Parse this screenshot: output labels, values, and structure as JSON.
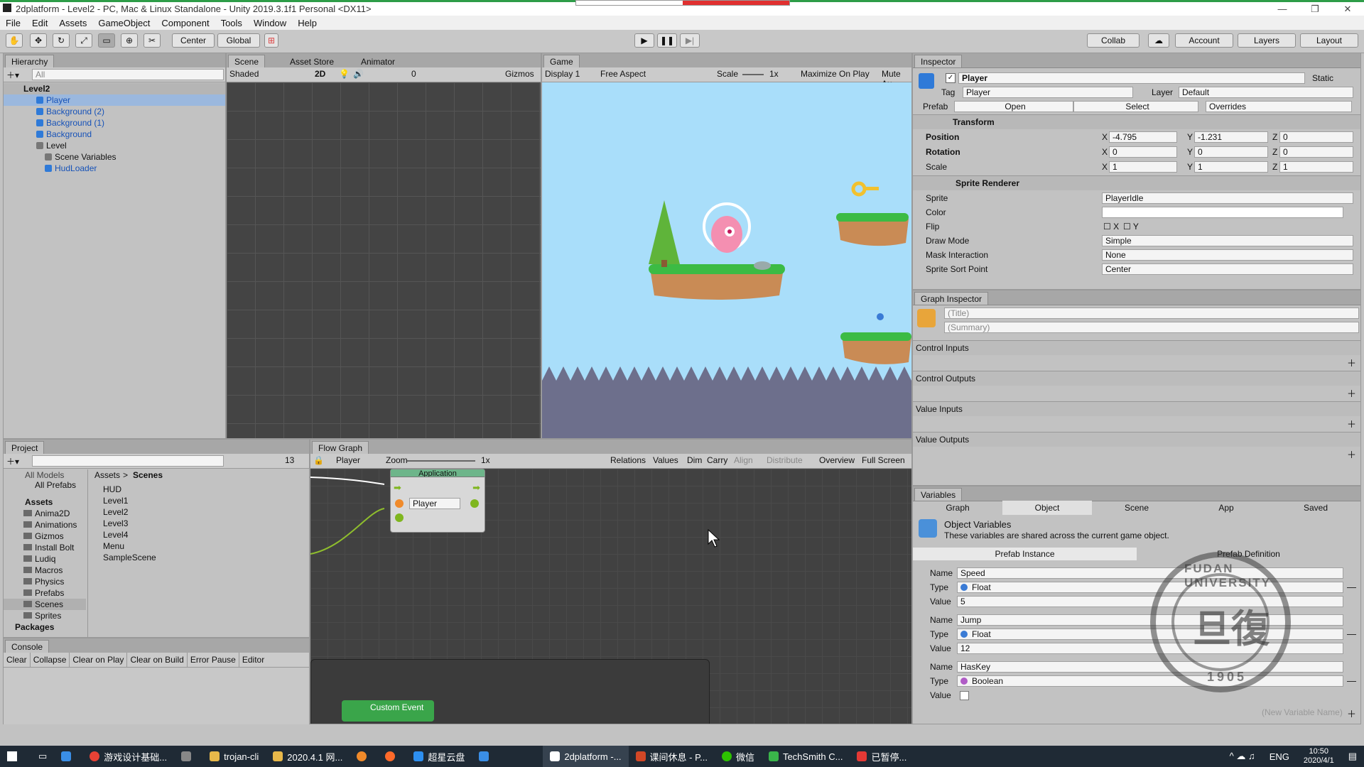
{
  "window": {
    "title": "2dplatform - Level2 - PC, Mac & Linux Standalone - Unity 2019.3.1f1 Personal <DX11>",
    "controls": [
      "—",
      "❐",
      "✕"
    ]
  },
  "menu": [
    "File",
    "Edit",
    "Assets",
    "GameObject",
    "Component",
    "Tools",
    "Window",
    "Help"
  ],
  "toolbar": {
    "center": "Center",
    "global": "Global",
    "collab": "Collab",
    "account": "Account",
    "layers": "Layers",
    "layout": "Layout"
  },
  "hierarchy": {
    "tab": "Hierarchy",
    "search": "All",
    "scene": "Level2",
    "items": [
      {
        "label": "Player",
        "blue": true
      },
      {
        "label": "Background (2)",
        "blue": true
      },
      {
        "label": "Background (1)",
        "blue": true
      },
      {
        "label": "Background",
        "blue": true
      },
      {
        "label": "Level",
        "blue": false
      },
      {
        "label": "Scene Variables",
        "blue": false
      },
      {
        "label": "HudLoader",
        "blue": true
      }
    ]
  },
  "scene": {
    "tabs": [
      "Scene",
      "Asset Store",
      "Animator"
    ],
    "shading": "Shaded",
    "mode": "2D",
    "hidden": "0",
    "gizmos": "Gizmos"
  },
  "game": {
    "tab": "Game",
    "display": "Display 1",
    "aspect": "Free Aspect",
    "scale_label": "Scale",
    "scale": "1x",
    "maximize": "Maximize On Play",
    "mute": "Mute Au"
  },
  "inspector": {
    "tab": "Inspector",
    "name": "Player",
    "static": "Static",
    "tag_label": "Tag",
    "tag": "Player",
    "layer_label": "Layer",
    "layer": "Default",
    "prefab_label": "Prefab",
    "open": "Open",
    "select": "Select",
    "overrides": "Overrides",
    "transform": {
      "title": "Transform",
      "position": {
        "label": "Position",
        "x": "-4.795",
        "y": "-1.231",
        "z": "0"
      },
      "rotation": {
        "label": "Rotation",
        "x": "0",
        "y": "0",
        "z": "0"
      },
      "scale": {
        "label": "Scale",
        "x": "1",
        "y": "1",
        "z": "1"
      }
    },
    "sprite_renderer": {
      "title": "Sprite Renderer",
      "sprite_label": "Sprite",
      "sprite": "PlayerIdle",
      "color_label": "Color",
      "flip_label": "Flip",
      "flip_x": "X",
      "flip_y": "Y",
      "draw_mode_label": "Draw Mode",
      "draw_mode": "Simple",
      "mask_label": "Mask Interaction",
      "mask": "None",
      "sort_label": "Sprite Sort Point",
      "sort": "Center"
    }
  },
  "graph_inspector": {
    "tab": "Graph Inspector",
    "title_ph": "(Title)",
    "summary_ph": "(Summary)",
    "sections": [
      "Control Inputs",
      "Control Outputs",
      "Value Inputs",
      "Value Outputs"
    ]
  },
  "variables": {
    "tab": "Variables",
    "tabs": [
      "Graph",
      "Object",
      "Scene",
      "App",
      "Saved"
    ],
    "heading": "Object Variables",
    "desc": "These variables are shared across the current game object.",
    "sub_tabs": [
      "Prefab Instance",
      "Prefab Definition"
    ],
    "vars": [
      {
        "name": "Speed",
        "type": "Float",
        "value": "5"
      },
      {
        "name": "Jump",
        "type": "Float",
        "value": "12"
      },
      {
        "name": "HasKey",
        "type": "Boolean",
        "value": ""
      }
    ],
    "new_var_ph": "(New Variable Name)"
  },
  "project": {
    "tab": "Project",
    "count": "13",
    "all_models": "All Models",
    "all_prefabs": "All Prefabs",
    "assets": "Assets",
    "scenes": "Scenes",
    "folders": [
      "Anima2D",
      "Animations",
      "Gizmos",
      "Install Bolt",
      "Ludiq",
      "Macros",
      "Physics",
      "Prefabs",
      "Scenes",
      "Sprites"
    ],
    "packages": "Packages",
    "scene_files": [
      "HUD",
      "Level1",
      "Level2",
      "Level3",
      "Level4",
      "Menu",
      "SampleScene"
    ]
  },
  "console": {
    "tab": "Console",
    "buttons": [
      "Clear",
      "Collapse",
      "Clear on Play",
      "Clear on Build",
      "Error Pause",
      "Editor"
    ]
  },
  "flow": {
    "tab": "Flow Graph",
    "target": "Player",
    "zoom_label": "Zoom",
    "zoom": "1x",
    "toolbar": [
      "Relations",
      "Values",
      "Dim",
      "Carry",
      "Align",
      "Distribute",
      "Overview",
      "Full Screen"
    ],
    "node_header": "Application",
    "node_value": "Player",
    "custom_event": "Custom Event"
  },
  "taskbar": {
    "items": [
      "游戏设计基础...",
      "trojan-cli",
      "2020.4.1 网...",
      "超星云盘",
      "2dplatform -...",
      "课间休息 - P...",
      "微信",
      "TechSmith C...",
      "已暂停..."
    ],
    "lang": "ENG",
    "time": "10:50",
    "date": "2020/4/1"
  },
  "watermark": {
    "text": "FUDAN UNIVERSITY",
    "year": "1905",
    "glyph": "旦復"
  }
}
